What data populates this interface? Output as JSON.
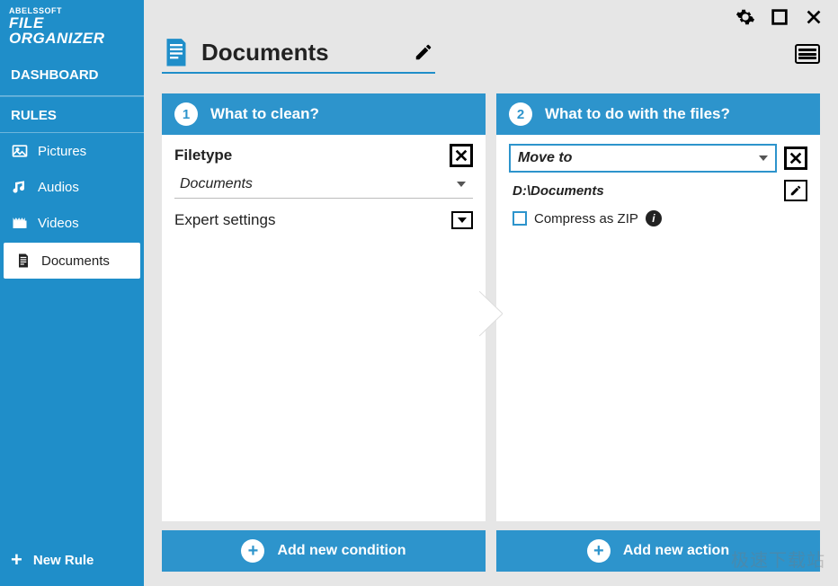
{
  "brand": {
    "top": "ABELSSOFT",
    "name": "FILE ORGANIZER"
  },
  "sidebar": {
    "dashboard": "DASHBOARD",
    "rules_header": "RULES",
    "items": [
      {
        "icon": "picture-icon",
        "label": "Pictures"
      },
      {
        "icon": "audio-icon",
        "label": "Audios"
      },
      {
        "icon": "video-icon",
        "label": "Videos"
      },
      {
        "icon": "document-icon",
        "label": "Documents"
      }
    ],
    "new_rule": "New Rule"
  },
  "title": {
    "text": "Documents"
  },
  "panel1": {
    "step": "1",
    "heading": "What to clean?",
    "filetype_label": "Filetype",
    "filetype_value": "Documents",
    "expert_label": "Expert settings"
  },
  "panel2": {
    "step": "2",
    "heading": "What to do with the files?",
    "action_value": "Move to",
    "path": "D:\\Documents",
    "zip_label": "Compress as ZIP"
  },
  "buttons": {
    "add_condition": "Add new condition",
    "add_action": "Add new action"
  },
  "watermark": "极速下载站"
}
